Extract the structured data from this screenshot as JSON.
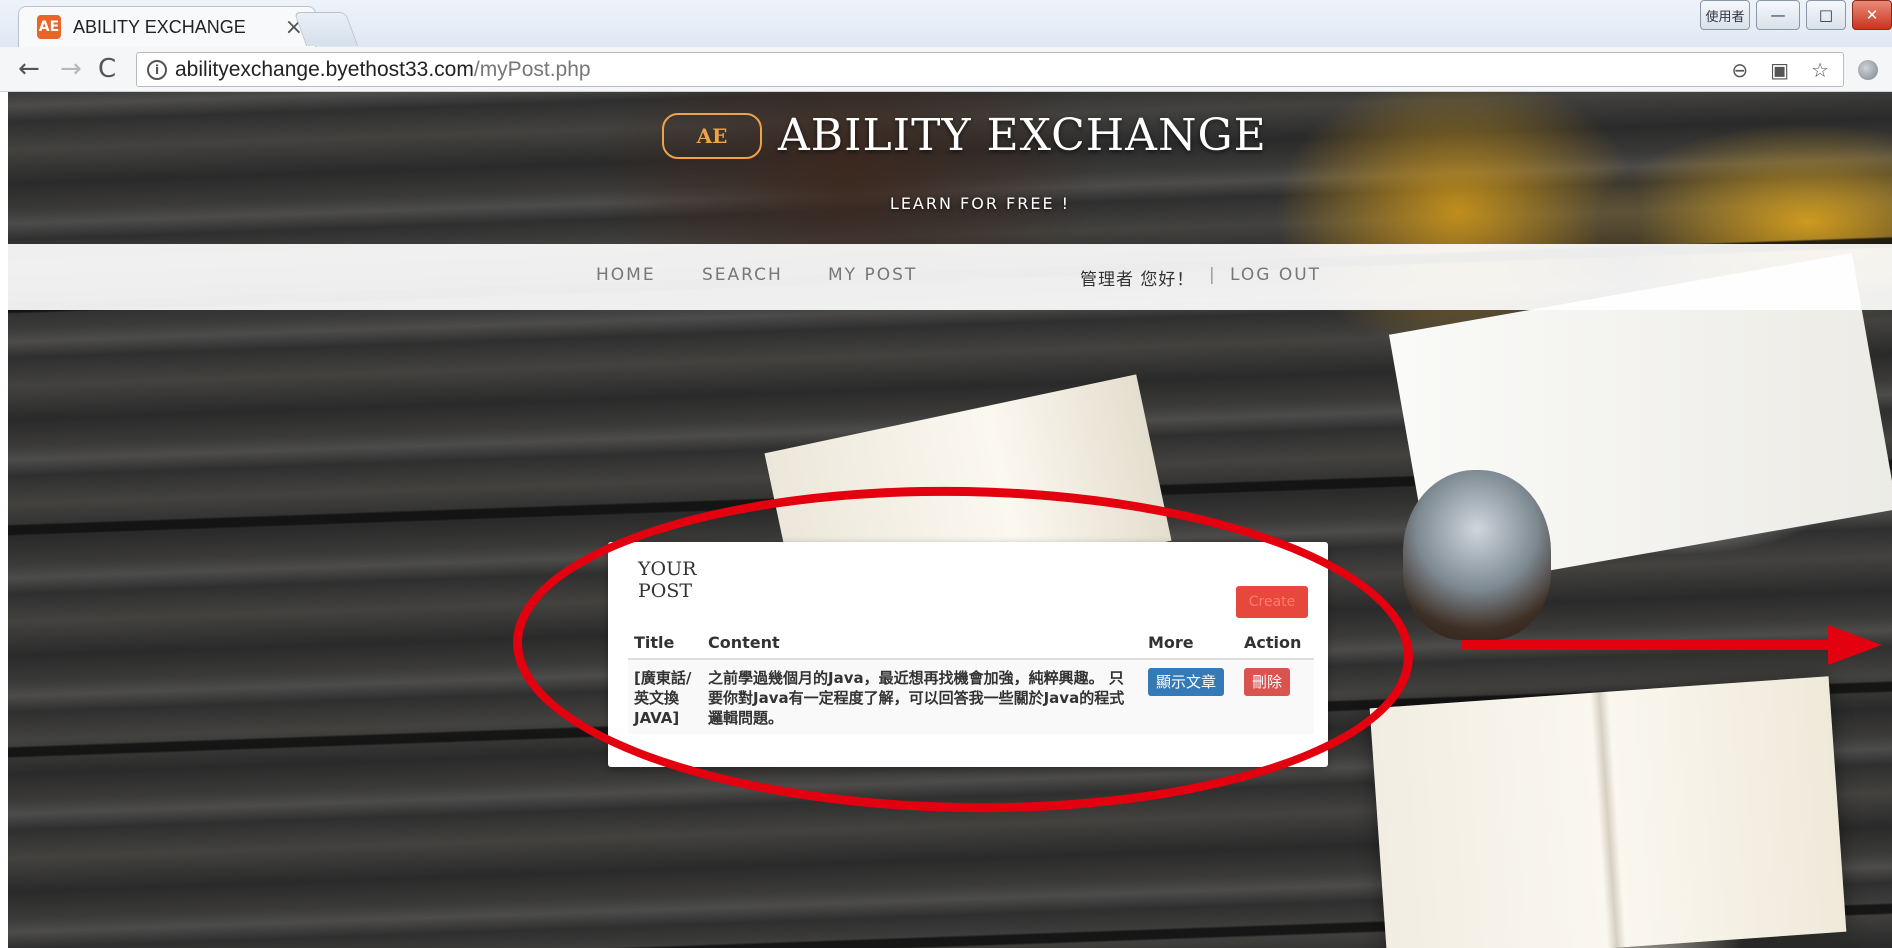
{
  "browser": {
    "tab": {
      "title": "ABILITY EXCHANGE",
      "close": "×",
      "favicon": "AE"
    },
    "window_controls": {
      "user": "使用者",
      "minimize": "—",
      "maximize": "□",
      "close": "✕"
    },
    "nav": {
      "back": "←",
      "forward": "→",
      "reload": "C"
    },
    "address": {
      "host": "abilityexchange.byethost33.com",
      "path": "/myPost.php"
    },
    "omnibox_icons": {
      "zoom": "zoom-out-icon",
      "translate": "translate-icon",
      "bookmark": "star-icon"
    }
  },
  "site": {
    "logo_text": "AE",
    "title": "ABILITY EXCHANGE",
    "tagline": "LEARN FOR FREE !"
  },
  "nav": {
    "home": "HOME",
    "search": "SEARCH",
    "my_post": "MY POST",
    "greeting": "管理者 您好！",
    "separator": "|",
    "logout": "LOG OUT"
  },
  "post_card": {
    "heading": "YOUR POST",
    "create_label": "Create",
    "columns": {
      "title": "Title",
      "content": "Content",
      "more": "More",
      "action": "Action"
    },
    "rows": [
      {
        "title": "[廣東話/英文換JAVA]",
        "content": "之前學過幾個月的Java，最近想再找機會加強，純粹興趣。 只要你對Java有一定程度了解，可以回答我一些關於Java的程式邏輯問題。",
        "more_label": "顯示文章",
        "action_label": "刪除"
      }
    ]
  },
  "colors": {
    "annotation_red": "#e3000f",
    "primary_button": "#337ab7",
    "danger_button": "#d9534f",
    "logo_orange": "#f0a24a"
  }
}
